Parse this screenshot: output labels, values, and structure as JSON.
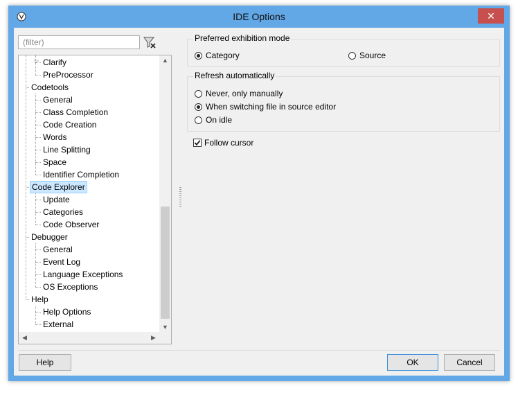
{
  "window": {
    "title": "IDE Options",
    "close_label": "✕"
  },
  "filter": {
    "placeholder": "(filter)"
  },
  "tree": {
    "items": [
      {
        "label": "Clarify",
        "level": 1
      },
      {
        "label": "PreProcessor",
        "level": 1
      },
      {
        "label": "Codetools",
        "level": 0
      },
      {
        "label": "General",
        "level": 1
      },
      {
        "label": "Class Completion",
        "level": 1
      },
      {
        "label": "Code Creation",
        "level": 1
      },
      {
        "label": "Words",
        "level": 1
      },
      {
        "label": "Line Splitting",
        "level": 1
      },
      {
        "label": "Space",
        "level": 1
      },
      {
        "label": "Identifier Completion",
        "level": 1
      },
      {
        "label": "Code Explorer",
        "level": 0,
        "selected": true
      },
      {
        "label": "Update",
        "level": 1
      },
      {
        "label": "Categories",
        "level": 1
      },
      {
        "label": "Code Observer",
        "level": 1
      },
      {
        "label": "Debugger",
        "level": 0
      },
      {
        "label": "General",
        "level": 1
      },
      {
        "label": "Event Log",
        "level": 1
      },
      {
        "label": "Language Exceptions",
        "level": 1
      },
      {
        "label": "OS Exceptions",
        "level": 1
      },
      {
        "label": "Help",
        "level": 0
      },
      {
        "label": "Help Options",
        "level": 1
      },
      {
        "label": "External",
        "level": 1
      }
    ]
  },
  "exhibition": {
    "title": "Preferred exhibition mode",
    "options": [
      {
        "label": "Category",
        "checked": true
      },
      {
        "label": "Source",
        "checked": false
      }
    ]
  },
  "refresh": {
    "title": "Refresh automatically",
    "options": [
      {
        "label": "Never, only manually",
        "checked": false
      },
      {
        "label": "When switching file in source editor",
        "checked": true
      },
      {
        "label": "On idle",
        "checked": false
      }
    ]
  },
  "follow_cursor": {
    "label": "Follow cursor",
    "checked": true
  },
  "buttons": {
    "help": "Help",
    "ok": "OK",
    "cancel": "Cancel"
  },
  "colors": {
    "title_bar": "#62a7e6",
    "close_button": "#c7504f",
    "selection": "#cce8ff",
    "default_button_border": "#3c8fd9"
  }
}
